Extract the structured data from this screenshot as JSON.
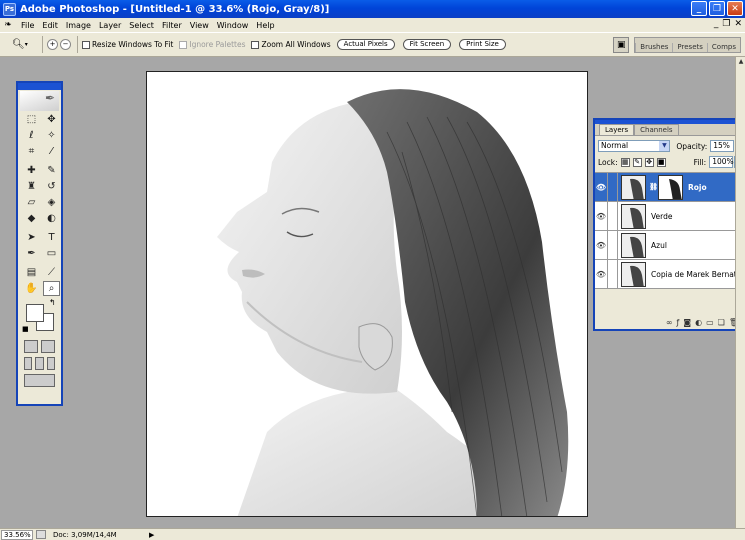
{
  "window": {
    "title": "Adobe Photoshop - [Untitled-1 @ 33.6% (Rojo, Gray/8)]"
  },
  "menu": [
    "File",
    "Edit",
    "Image",
    "Layer",
    "Select",
    "Filter",
    "View",
    "Window",
    "Help"
  ],
  "options": {
    "resize_windows": "Resize Windows To Fit",
    "ignore_palettes": "Ignore Palettes",
    "zoom_all": "Zoom All Windows",
    "actual_pixels": "Actual Pixels",
    "fit_screen": "Fit Screen",
    "print_size": "Print Size"
  },
  "palette_well": [
    "Brushes",
    "Presets",
    "Comps"
  ],
  "status": {
    "zoom": "33.56%",
    "doc": "Doc: 3,09M/14,4M"
  },
  "layers_panel": {
    "tabs": [
      "Layers",
      "Channels"
    ],
    "blend_mode": "Normal",
    "opacity_label": "Opacity:",
    "opacity": "15%",
    "lock_label": "Lock:",
    "fill_label": "Fill:",
    "fill": "100%",
    "layers": [
      {
        "name": "Rojo",
        "selected": true
      },
      {
        "name": "Verde",
        "selected": false
      },
      {
        "name": "Azul",
        "selected": false
      },
      {
        "name": "Copia de Marek Bernat",
        "selected": false
      }
    ]
  },
  "icons": {
    "app": "photoshop-icon",
    "zoom_tool": "magnifier-icon",
    "visibility": "eye-icon"
  },
  "colors": {
    "title_bar": "#0a5ce8",
    "selected_layer": "#316ac5",
    "workspace": "#a7a7a7",
    "chrome": "#ece9d8"
  }
}
